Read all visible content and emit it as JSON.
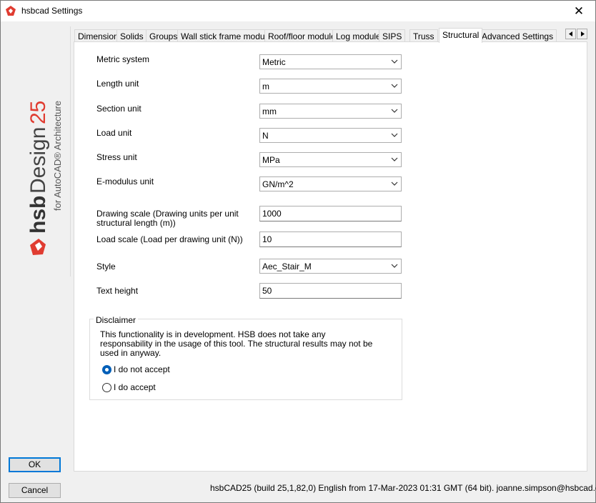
{
  "window": {
    "title": "hsbcad Settings",
    "close_symbol": "✕"
  },
  "branding": {
    "brand_bold": "hsb",
    "brand_light": "Design",
    "version": "25",
    "subtitle": "for AutoCAD® Architecture",
    "accent_color": "#e03c31"
  },
  "tabs": [
    {
      "label": "Dimension"
    },
    {
      "label": "Solids"
    },
    {
      "label": "Groups"
    },
    {
      "label": "Wall stick frame module"
    },
    {
      "label": "Roof/floor module"
    },
    {
      "label": "Log module"
    },
    {
      "label": "SIPS"
    },
    {
      "label": "Truss"
    },
    {
      "label": "Structural",
      "active": true
    },
    {
      "label": "Advanced Settings"
    }
  ],
  "form": {
    "metric_system": {
      "label": "Metric system",
      "value": "Metric"
    },
    "length_unit": {
      "label": "Length unit",
      "value": "m"
    },
    "section_unit": {
      "label": "Section unit",
      "value": "mm"
    },
    "load_unit": {
      "label": "Load unit",
      "value": "N"
    },
    "stress_unit": {
      "label": "Stress unit",
      "value": "MPa"
    },
    "emodulus_unit": {
      "label": "E-modulus unit",
      "value": "GN/m^2"
    },
    "drawing_scale": {
      "label_line1": "Drawing scale (Drawing units per unit",
      "label_line2": "structural length (m))",
      "value": "1000"
    },
    "load_scale": {
      "label": "Load scale (Load per drawing unit (N))",
      "value": "10"
    },
    "style": {
      "label": "Style",
      "value": "Aec_Stair_M"
    },
    "text_height": {
      "label": "Text height",
      "value": "50"
    }
  },
  "disclaimer": {
    "title": "Disclaimer",
    "line1": "This functionality is in development. HSB does not take any",
    "line2": "responsability in the usage of this tool. The structural results may not be",
    "line3": "used in anyway.",
    "option_not_accept": "I do not accept",
    "option_accept": "I do accept",
    "selected": "not_accept"
  },
  "buttons": {
    "ok": "OK",
    "cancel": "Cancel"
  },
  "status_text": "hsbCAD25 (build 25,1,82,0) English from 17-Mar-2023 01:31 GMT (64 bit). joanne.simpson@hsbcad.com"
}
